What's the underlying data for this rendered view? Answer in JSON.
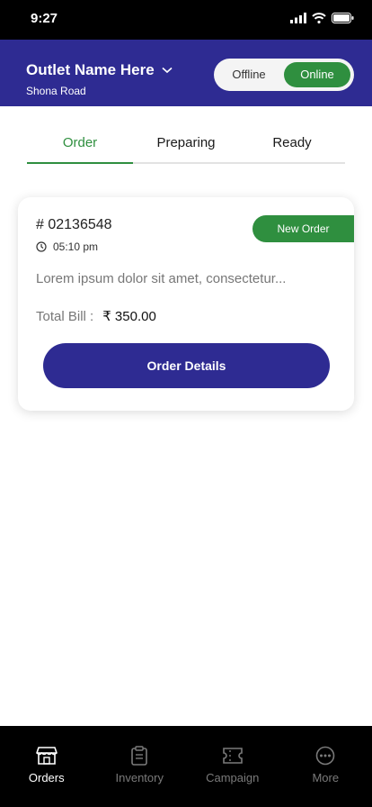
{
  "status_bar": {
    "time": "9:27"
  },
  "header": {
    "outlet_name": "Outlet Name Here",
    "outlet_location": "Shona Road",
    "toggle": {
      "offline_label": "Offline",
      "online_label": "Online",
      "selected": "Online"
    }
  },
  "tabs": [
    {
      "label": "Order",
      "active": true
    },
    {
      "label": "Preparing",
      "active": false
    },
    {
      "label": "Ready",
      "active": false
    }
  ],
  "order_card": {
    "order_id": "# 02136548",
    "time": "05:10 pm",
    "badge": "New Order",
    "description": "Lorem ipsum dolor sit amet, consectetur...",
    "total_label": "Total Bill :",
    "total_value": "₹ 350.00",
    "button_label": "Order Details"
  },
  "bottom_nav": [
    {
      "label": "Orders",
      "icon": "store-icon",
      "active": true
    },
    {
      "label": "Inventory",
      "icon": "clipboard-icon",
      "active": false
    },
    {
      "label": "Campaign",
      "icon": "ticket-icon",
      "active": false
    },
    {
      "label": "More",
      "icon": "more-icon",
      "active": false
    }
  ],
  "colors": {
    "primary": "#2e2b92",
    "accent_green": "#2f8f3f",
    "nav_bg": "#000000"
  }
}
